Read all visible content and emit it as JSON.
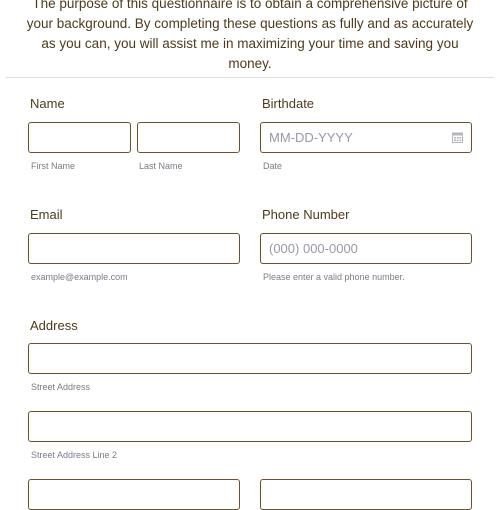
{
  "intro": {
    "text": "The purpose of this questionnaire is to obtain a comprehensive picture of your background. By completing these questions as fully and as accurately as you can, you will assist me in maximizing your time and saving you money."
  },
  "name": {
    "label": "Name",
    "first_sublabel": "First Name",
    "last_sublabel": "Last Name"
  },
  "birthdate": {
    "label": "Birthdate",
    "placeholder": "MM-DD-YYYY",
    "sublabel": "Date"
  },
  "email": {
    "label": "Email",
    "sublabel": "example@example.com"
  },
  "phone": {
    "label": "Phone Number",
    "placeholder": "(000) 000-0000",
    "sublabel": "Please enter a valid phone number."
  },
  "address": {
    "label": "Address",
    "street_sublabel": "Street Address",
    "street2_sublabel": "Street Address Line 2"
  },
  "colors": {
    "text": "#4d3a1e",
    "border": "#6b5232",
    "sublabel": "#7c7a86",
    "placeholder": "#9a97a8"
  }
}
